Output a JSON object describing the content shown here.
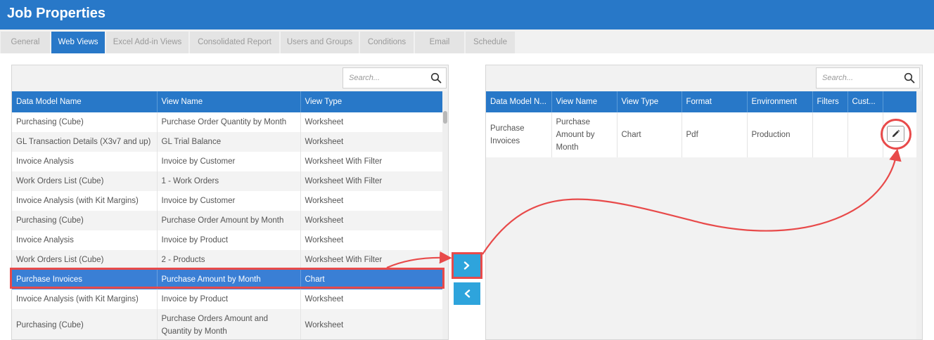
{
  "window": {
    "title": "Job Properties"
  },
  "tabs": [
    {
      "label": "General",
      "active": false
    },
    {
      "label": "Web Views",
      "active": true
    },
    {
      "label": "Excel Add-in Views",
      "active": false
    },
    {
      "label": "Consolidated Report",
      "active": false
    },
    {
      "label": "Users and Groups",
      "active": false
    },
    {
      "label": "Conditions",
      "active": false
    },
    {
      "label": "Email",
      "active": false
    },
    {
      "label": "Schedule",
      "active": false
    }
  ],
  "left_panel": {
    "search_placeholder": "Search...",
    "columns": [
      "Data Model Name",
      "View Name",
      "View Type"
    ],
    "rows": [
      [
        "Purchasing (Cube)",
        "Purchase Order Quantity by Month",
        "Worksheet"
      ],
      [
        "GL Transaction Details (X3v7 and up)",
        "GL Trial Balance",
        "Worksheet"
      ],
      [
        "Invoice Analysis",
        "Invoice by Customer",
        "Worksheet With Filter"
      ],
      [
        "Work Orders List (Cube)",
        "1 - Work Orders",
        "Worksheet With Filter"
      ],
      [
        "Invoice Analysis (with Kit Margins)",
        "Invoice by Customer",
        "Worksheet"
      ],
      [
        "Purchasing (Cube)",
        "Purchase Order Amount by Month",
        "Worksheet"
      ],
      [
        "Invoice Analysis",
        "Invoice by Product",
        "Worksheet"
      ],
      [
        "Work Orders List (Cube)",
        "2 - Products",
        "Worksheet With Filter"
      ],
      [
        "Purchase Invoices",
        "Purchase Amount by Month",
        "Chart"
      ],
      [
        "Invoice Analysis (with Kit Margins)",
        "Invoice by Product",
        "Worksheet"
      ],
      [
        "Purchasing (Cube)",
        "Purchase Orders Amount and Quantity by Month",
        "Worksheet"
      ]
    ],
    "selected_row_index": 8
  },
  "right_panel": {
    "search_placeholder": "Search...",
    "columns": [
      "Data Model N...",
      "View Name",
      "View Type",
      "Format",
      "Environment",
      "Filters",
      "Cust..."
    ],
    "rows": [
      [
        "Purchase Invoices",
        "Purchase Amount by Month",
        "Chart",
        "Pdf",
        "Production",
        "",
        ""
      ]
    ]
  },
  "icons": {
    "search": "search-icon",
    "move_right": "chevron-right-icon",
    "move_left": "chevron-left-icon",
    "edit": "pencil-icon"
  },
  "colors": {
    "accent": "#2878c8",
    "selected_row": "#3a7fd5",
    "move_button": "#2ea4dc",
    "annotation": "#e84a4a"
  }
}
